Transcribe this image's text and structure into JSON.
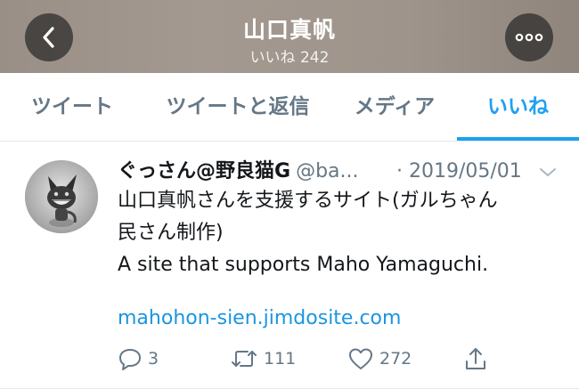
{
  "header": {
    "title": "山口真帆",
    "subtitle": "いいね 242",
    "back_icon": "chevron-left-icon",
    "more_icon": "more-horizontal-icon"
  },
  "tabs": [
    {
      "label": "ツイート",
      "active": false
    },
    {
      "label": "ツイートと返信",
      "active": false
    },
    {
      "label": "メディア",
      "active": false
    },
    {
      "label": "いいね",
      "active": true
    }
  ],
  "tweet": {
    "display_name": "ぐっさん@野良猫G",
    "handle": "@ba...",
    "date": "· 2019/05/01",
    "text_lines": [
      "山口真帆さんを支援するサイト(ガルちゃん",
      "民さん制作)",
      "A site that supports Maho Yamaguchi."
    ],
    "link": "mahohon-sien.jimdosite.com",
    "actions": {
      "reply_count": "3",
      "retweet_count": "111",
      "like_count": "272"
    }
  },
  "colors": {
    "accent": "#1da1f2",
    "link": "#1b95e0",
    "secondary_text": "#657786",
    "header_bg": "#a1978e"
  }
}
